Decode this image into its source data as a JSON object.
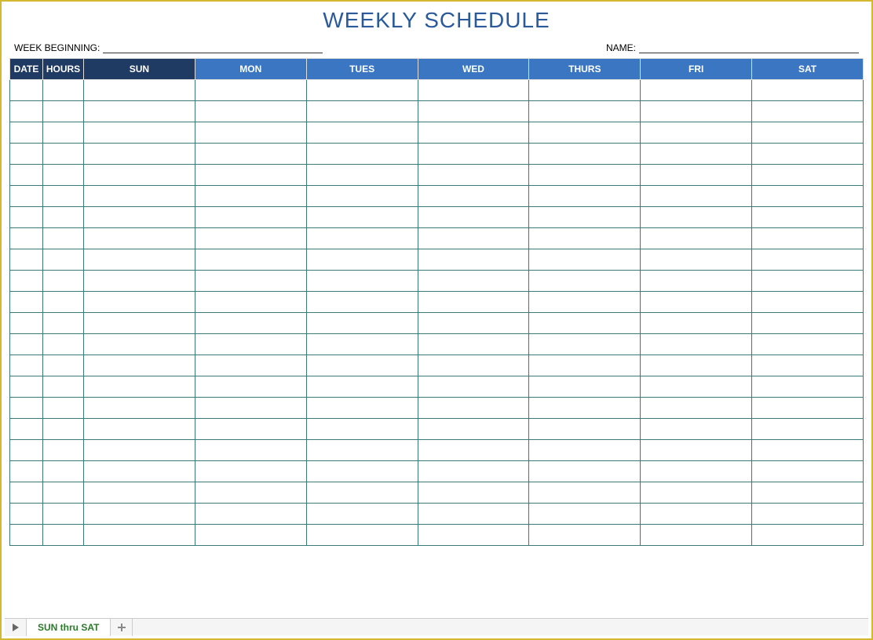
{
  "title": "WEEKLY SCHEDULE",
  "fields": {
    "week_beginning_label": "WEEK BEGINNING:",
    "name_label": "NAME:"
  },
  "columns": {
    "date": "DATE",
    "hours": "HOURS",
    "days": [
      "SUN",
      "MON",
      "TUES",
      "WED",
      "THURS",
      "FRI",
      "SAT"
    ]
  },
  "row_count": 22,
  "footer": {
    "tab_label": "SUN thru SAT"
  }
}
